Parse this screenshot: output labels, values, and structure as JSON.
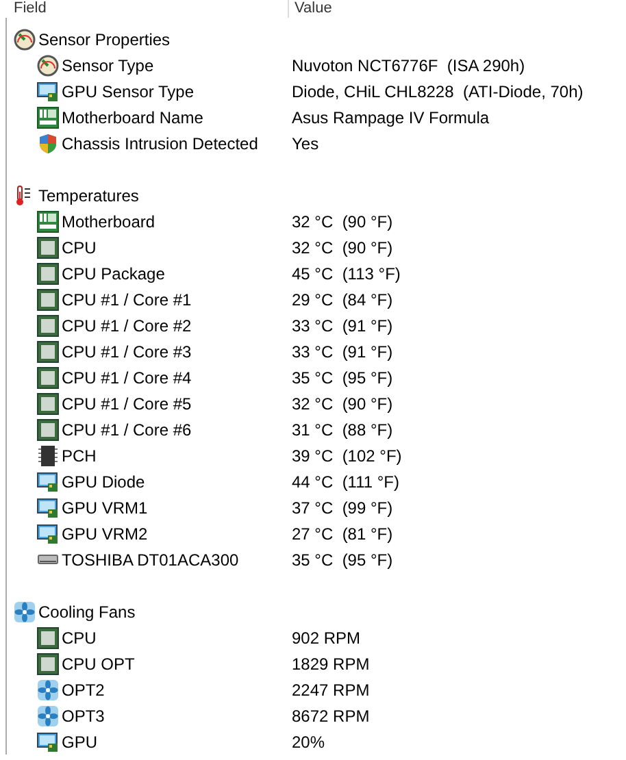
{
  "table": {
    "columns": [
      "Field",
      "Value"
    ],
    "groups": [
      {
        "label": "Sensor Properties",
        "kind": "gauge",
        "rows": [
          {
            "kind": "gauge",
            "field": "Sensor Type",
            "value": "Nuvoton NCT6776F  (ISA 290h)"
          },
          {
            "kind": "gpu",
            "field": "GPU Sensor Type",
            "value": "Diode, CHiL CHL8228  (ATI-Diode, 70h)"
          },
          {
            "kind": "board",
            "field": "Motherboard Name",
            "value": "Asus Rampage IV Formula"
          },
          {
            "kind": "shield",
            "field": "Chassis Intrusion Detected",
            "value": "Yes"
          }
        ]
      },
      {
        "label": "Temperatures",
        "kind": "thermo",
        "rows": [
          {
            "kind": "board",
            "field": "Motherboard",
            "value": "32 °C  (90 °F)"
          },
          {
            "kind": "chip",
            "field": "CPU",
            "value": "32 °C  (90 °F)"
          },
          {
            "kind": "chip",
            "field": "CPU Package",
            "value": "45 °C  (113 °F)"
          },
          {
            "kind": "chip",
            "field": "CPU #1 / Core #1",
            "value": "29 °C  (84 °F)"
          },
          {
            "kind": "chip",
            "field": "CPU #1 / Core #2",
            "value": "33 °C  (91 °F)"
          },
          {
            "kind": "chip",
            "field": "CPU #1 / Core #3",
            "value": "33 °C  (91 °F)"
          },
          {
            "kind": "chip",
            "field": "CPU #1 / Core #4",
            "value": "35 °C  (95 °F)"
          },
          {
            "kind": "chip",
            "field": "CPU #1 / Core #5",
            "value": "32 °C  (90 °F)"
          },
          {
            "kind": "chip",
            "field": "CPU #1 / Core #6",
            "value": "31 °C  (88 °F)"
          },
          {
            "kind": "pch",
            "field": "PCH",
            "value": "39 °C  (102 °F)"
          },
          {
            "kind": "gpu",
            "field": "GPU Diode",
            "value": "44 °C  (111 °F)"
          },
          {
            "kind": "gpu",
            "field": "GPU VRM1",
            "value": "37 °C  (99 °F)"
          },
          {
            "kind": "gpu",
            "field": "GPU VRM2",
            "value": "27 °C  (81 °F)"
          },
          {
            "kind": "drive",
            "field": "TOSHIBA DT01ACA300",
            "value": "35 °C  (95 °F)"
          }
        ]
      },
      {
        "label": "Cooling Fans",
        "kind": "fan",
        "rows": [
          {
            "kind": "chip",
            "field": "CPU",
            "value": "902 RPM"
          },
          {
            "kind": "chip",
            "field": "CPU OPT",
            "value": "1829 RPM"
          },
          {
            "kind": "fan",
            "field": "OPT2",
            "value": "2247 RPM"
          },
          {
            "kind": "fan",
            "field": "OPT3",
            "value": "8672 RPM"
          },
          {
            "kind": "gpu",
            "field": "GPU",
            "value": "20%"
          }
        ]
      }
    ]
  }
}
